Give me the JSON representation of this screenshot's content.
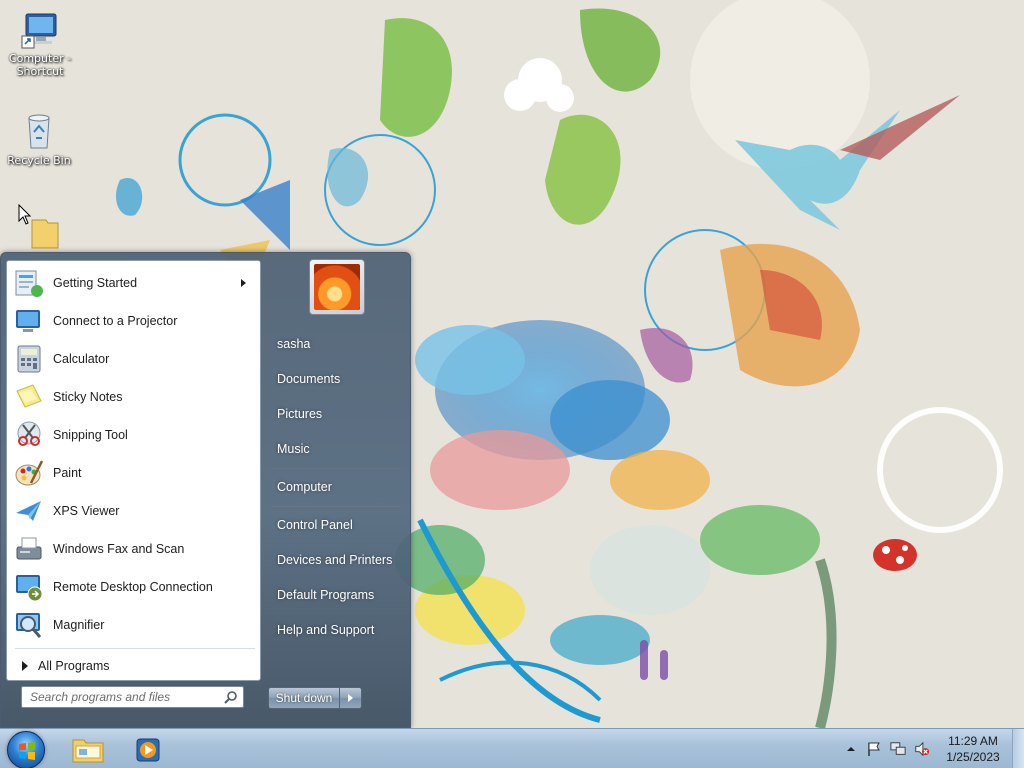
{
  "desktop": {
    "icons": [
      {
        "label": "Computer - Shortcut",
        "icon": "computer-icon"
      },
      {
        "label": "Recycle Bin",
        "icon": "recycle-bin-icon"
      },
      {
        "label": "",
        "icon": "folder-icon"
      }
    ]
  },
  "start_menu": {
    "programs": [
      {
        "label": "Getting Started",
        "icon": "getting-started-icon",
        "has_submenu": true
      },
      {
        "label": "Connect to a Projector",
        "icon": "projector-icon"
      },
      {
        "label": "Calculator",
        "icon": "calculator-icon"
      },
      {
        "label": "Sticky Notes",
        "icon": "sticky-notes-icon"
      },
      {
        "label": "Snipping Tool",
        "icon": "scissors-icon"
      },
      {
        "label": "Paint",
        "icon": "paint-palette-icon"
      },
      {
        "label": "XPS Viewer",
        "icon": "xps-viewer-icon"
      },
      {
        "label": "Windows Fax and Scan",
        "icon": "fax-icon"
      },
      {
        "label": "Remote Desktop Connection",
        "icon": "remote-desktop-icon"
      },
      {
        "label": "Magnifier",
        "icon": "magnifier-icon"
      }
    ],
    "all_programs": "All Programs",
    "search": {
      "placeholder": "Search programs and files",
      "value": ""
    },
    "user_picture": "flower-avatar",
    "right_items": [
      "sasha",
      "Documents",
      "Pictures",
      "Music",
      "Computer",
      "Control Panel",
      "Devices and Printers",
      "Default Programs",
      "Help and Support"
    ],
    "shutdown_label": "Shut down"
  },
  "taskbar": {
    "pinned": [
      {
        "name": "Windows Explorer",
        "icon": "explorer-folder-icon"
      },
      {
        "name": "Windows Media Player",
        "icon": "media-player-icon"
      }
    ],
    "tray_icons": [
      "show-hidden-icons-chevron",
      "action-center-flag-icon",
      "network-icon",
      "volume-muted-icon"
    ],
    "clock": {
      "time": "11:29 AM",
      "date": "1/25/2023"
    }
  },
  "colors": {
    "taskbar": "#a9c2da",
    "start_menu_frame": "#526a80",
    "desktop_bg": "#e6e3da"
  }
}
